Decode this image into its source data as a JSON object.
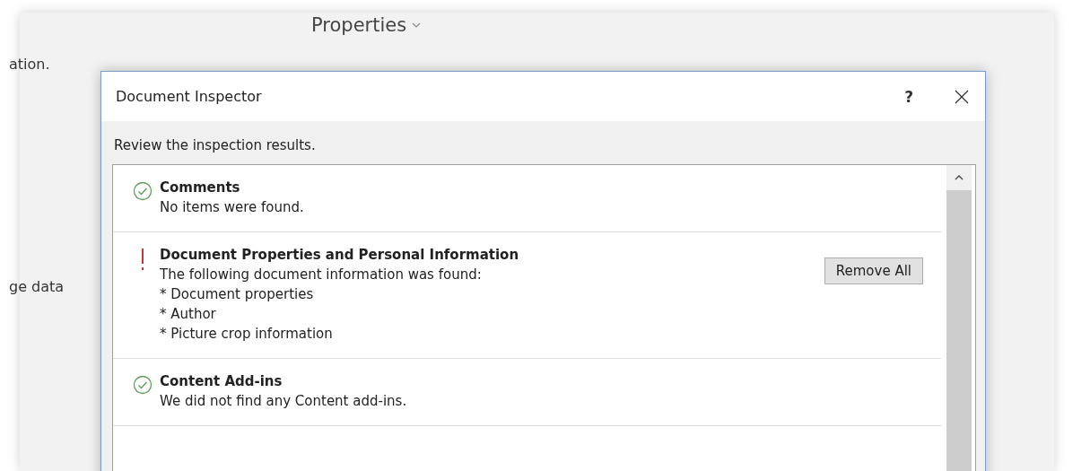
{
  "background": {
    "left_texts": [
      "ation.",
      "ge data"
    ],
    "heading": "Properties"
  },
  "dialog": {
    "title": "Document Inspector",
    "help": "?",
    "prompt": "Review the inspection results.",
    "results": [
      {
        "kind": "clean",
        "title": "Comments",
        "lines": [
          "No items were found."
        ]
      },
      {
        "kind": "found",
        "title": "Document Properties and Personal Information",
        "lines": [
          "The following document information was found:",
          "* Document properties",
          "* Author",
          "* Picture crop information"
        ],
        "button": "Remove All"
      },
      {
        "kind": "clean",
        "title": "Content Add-ins",
        "lines": [
          "We did not find any Content add-ins."
        ]
      }
    ]
  }
}
